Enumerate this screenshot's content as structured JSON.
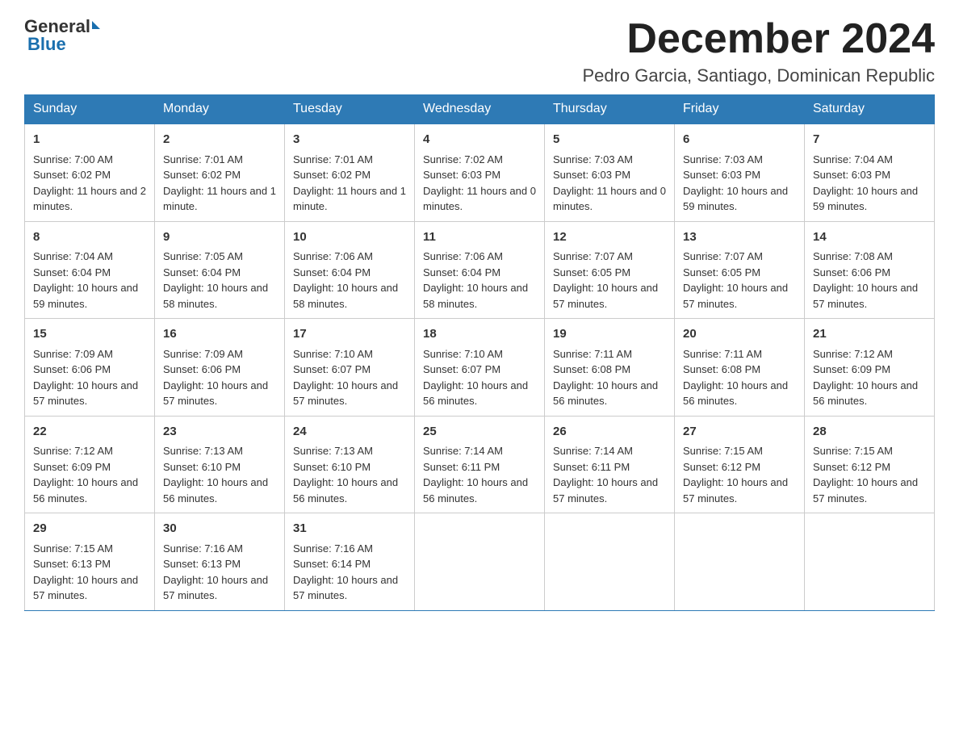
{
  "header": {
    "logo_general": "General",
    "logo_blue": "Blue",
    "month_title": "December 2024",
    "location": "Pedro Garcia, Santiago, Dominican Republic"
  },
  "days_of_week": [
    "Sunday",
    "Monday",
    "Tuesday",
    "Wednesday",
    "Thursday",
    "Friday",
    "Saturday"
  ],
  "weeks": [
    [
      {
        "day": "1",
        "sunrise": "7:00 AM",
        "sunset": "6:02 PM",
        "daylight": "11 hours and 2 minutes."
      },
      {
        "day": "2",
        "sunrise": "7:01 AM",
        "sunset": "6:02 PM",
        "daylight": "11 hours and 1 minute."
      },
      {
        "day": "3",
        "sunrise": "7:01 AM",
        "sunset": "6:02 PM",
        "daylight": "11 hours and 1 minute."
      },
      {
        "day": "4",
        "sunrise": "7:02 AM",
        "sunset": "6:03 PM",
        "daylight": "11 hours and 0 minutes."
      },
      {
        "day": "5",
        "sunrise": "7:03 AM",
        "sunset": "6:03 PM",
        "daylight": "11 hours and 0 minutes."
      },
      {
        "day": "6",
        "sunrise": "7:03 AM",
        "sunset": "6:03 PM",
        "daylight": "10 hours and 59 minutes."
      },
      {
        "day": "7",
        "sunrise": "7:04 AM",
        "sunset": "6:03 PM",
        "daylight": "10 hours and 59 minutes."
      }
    ],
    [
      {
        "day": "8",
        "sunrise": "7:04 AM",
        "sunset": "6:04 PM",
        "daylight": "10 hours and 59 minutes."
      },
      {
        "day": "9",
        "sunrise": "7:05 AM",
        "sunset": "6:04 PM",
        "daylight": "10 hours and 58 minutes."
      },
      {
        "day": "10",
        "sunrise": "7:06 AM",
        "sunset": "6:04 PM",
        "daylight": "10 hours and 58 minutes."
      },
      {
        "day": "11",
        "sunrise": "7:06 AM",
        "sunset": "6:04 PM",
        "daylight": "10 hours and 58 minutes."
      },
      {
        "day": "12",
        "sunrise": "7:07 AM",
        "sunset": "6:05 PM",
        "daylight": "10 hours and 57 minutes."
      },
      {
        "day": "13",
        "sunrise": "7:07 AM",
        "sunset": "6:05 PM",
        "daylight": "10 hours and 57 minutes."
      },
      {
        "day": "14",
        "sunrise": "7:08 AM",
        "sunset": "6:06 PM",
        "daylight": "10 hours and 57 minutes."
      }
    ],
    [
      {
        "day": "15",
        "sunrise": "7:09 AM",
        "sunset": "6:06 PM",
        "daylight": "10 hours and 57 minutes."
      },
      {
        "day": "16",
        "sunrise": "7:09 AM",
        "sunset": "6:06 PM",
        "daylight": "10 hours and 57 minutes."
      },
      {
        "day": "17",
        "sunrise": "7:10 AM",
        "sunset": "6:07 PM",
        "daylight": "10 hours and 57 minutes."
      },
      {
        "day": "18",
        "sunrise": "7:10 AM",
        "sunset": "6:07 PM",
        "daylight": "10 hours and 56 minutes."
      },
      {
        "day": "19",
        "sunrise": "7:11 AM",
        "sunset": "6:08 PM",
        "daylight": "10 hours and 56 minutes."
      },
      {
        "day": "20",
        "sunrise": "7:11 AM",
        "sunset": "6:08 PM",
        "daylight": "10 hours and 56 minutes."
      },
      {
        "day": "21",
        "sunrise": "7:12 AM",
        "sunset": "6:09 PM",
        "daylight": "10 hours and 56 minutes."
      }
    ],
    [
      {
        "day": "22",
        "sunrise": "7:12 AM",
        "sunset": "6:09 PM",
        "daylight": "10 hours and 56 minutes."
      },
      {
        "day": "23",
        "sunrise": "7:13 AM",
        "sunset": "6:10 PM",
        "daylight": "10 hours and 56 minutes."
      },
      {
        "day": "24",
        "sunrise": "7:13 AM",
        "sunset": "6:10 PM",
        "daylight": "10 hours and 56 minutes."
      },
      {
        "day": "25",
        "sunrise": "7:14 AM",
        "sunset": "6:11 PM",
        "daylight": "10 hours and 56 minutes."
      },
      {
        "day": "26",
        "sunrise": "7:14 AM",
        "sunset": "6:11 PM",
        "daylight": "10 hours and 57 minutes."
      },
      {
        "day": "27",
        "sunrise": "7:15 AM",
        "sunset": "6:12 PM",
        "daylight": "10 hours and 57 minutes."
      },
      {
        "day": "28",
        "sunrise": "7:15 AM",
        "sunset": "6:12 PM",
        "daylight": "10 hours and 57 minutes."
      }
    ],
    [
      {
        "day": "29",
        "sunrise": "7:15 AM",
        "sunset": "6:13 PM",
        "daylight": "10 hours and 57 minutes."
      },
      {
        "day": "30",
        "sunrise": "7:16 AM",
        "sunset": "6:13 PM",
        "daylight": "10 hours and 57 minutes."
      },
      {
        "day": "31",
        "sunrise": "7:16 AM",
        "sunset": "6:14 PM",
        "daylight": "10 hours and 57 minutes."
      },
      null,
      null,
      null,
      null
    ]
  ]
}
